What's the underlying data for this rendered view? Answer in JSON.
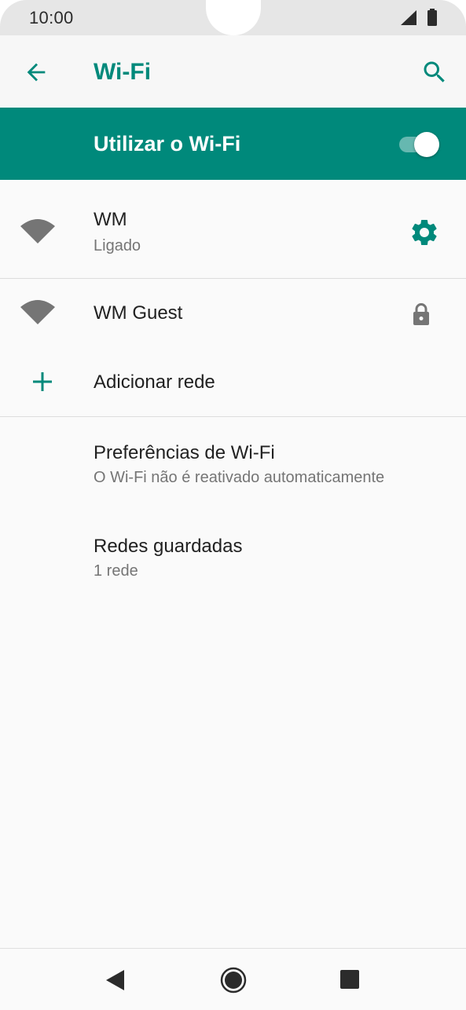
{
  "status_bar": {
    "time": "10:00",
    "signal_icon": "cellular-signal-icon",
    "battery_icon": "battery-icon"
  },
  "app_bar": {
    "back_icon": "arrow-back-icon",
    "title": "Wi-Fi",
    "search_icon": "search-icon"
  },
  "master_switch": {
    "label": "Utilizar o Wi-Fi",
    "enabled": true
  },
  "networks": [
    {
      "name": "WM",
      "status": "Ligado",
      "icon": "wifi-signal-icon",
      "action_icon": "gear-icon"
    },
    {
      "name": "WM Guest",
      "icon": "wifi-signal-icon",
      "action_icon": "lock-icon"
    }
  ],
  "add_network": {
    "label": "Adicionar rede",
    "icon": "plus-icon"
  },
  "preferences": {
    "title": "Preferências de Wi-Fi",
    "subtitle": "O Wi-Fi não é reativado automaticamente"
  },
  "saved_networks": {
    "title": "Redes guardadas",
    "subtitle": "1 rede"
  },
  "nav_bar": {
    "back_icon": "nav-back-triangle-icon",
    "home_icon": "nav-home-circle-icon",
    "recents_icon": "nav-recents-square-icon"
  },
  "colors": {
    "accent": "#00897b",
    "icon_gray": "#757575",
    "text_primary": "#212121",
    "text_secondary": "#757575"
  }
}
